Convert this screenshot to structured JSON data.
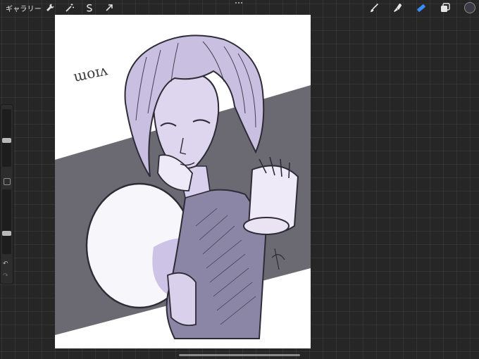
{
  "topbar": {
    "gallery_label": "ギャラリー",
    "tools_left": [
      "wrench-icon",
      "magic-wand-icon",
      "selection-icon",
      "transform-arrow-icon"
    ],
    "tools_right": [
      "brush-icon",
      "smudge-icon",
      "eraser-icon",
      "layers-icon"
    ],
    "active_tool": "eraser-icon",
    "current_color": "#3c3a46"
  },
  "canvas": {
    "signature_text": "ɯoɪʌ",
    "colors": {
      "background": "#ffffff",
      "band": "#6b6a72",
      "hair": "#c9bfe0",
      "skin": "#ddd6ee",
      "shadow": "#b9a9dc",
      "line": "#2d2b36"
    }
  },
  "sidebar": {
    "brush_size_level": 0.45,
    "opacity_level": 0.3,
    "undo_glyph": "↶",
    "redo_glyph": "↷"
  }
}
